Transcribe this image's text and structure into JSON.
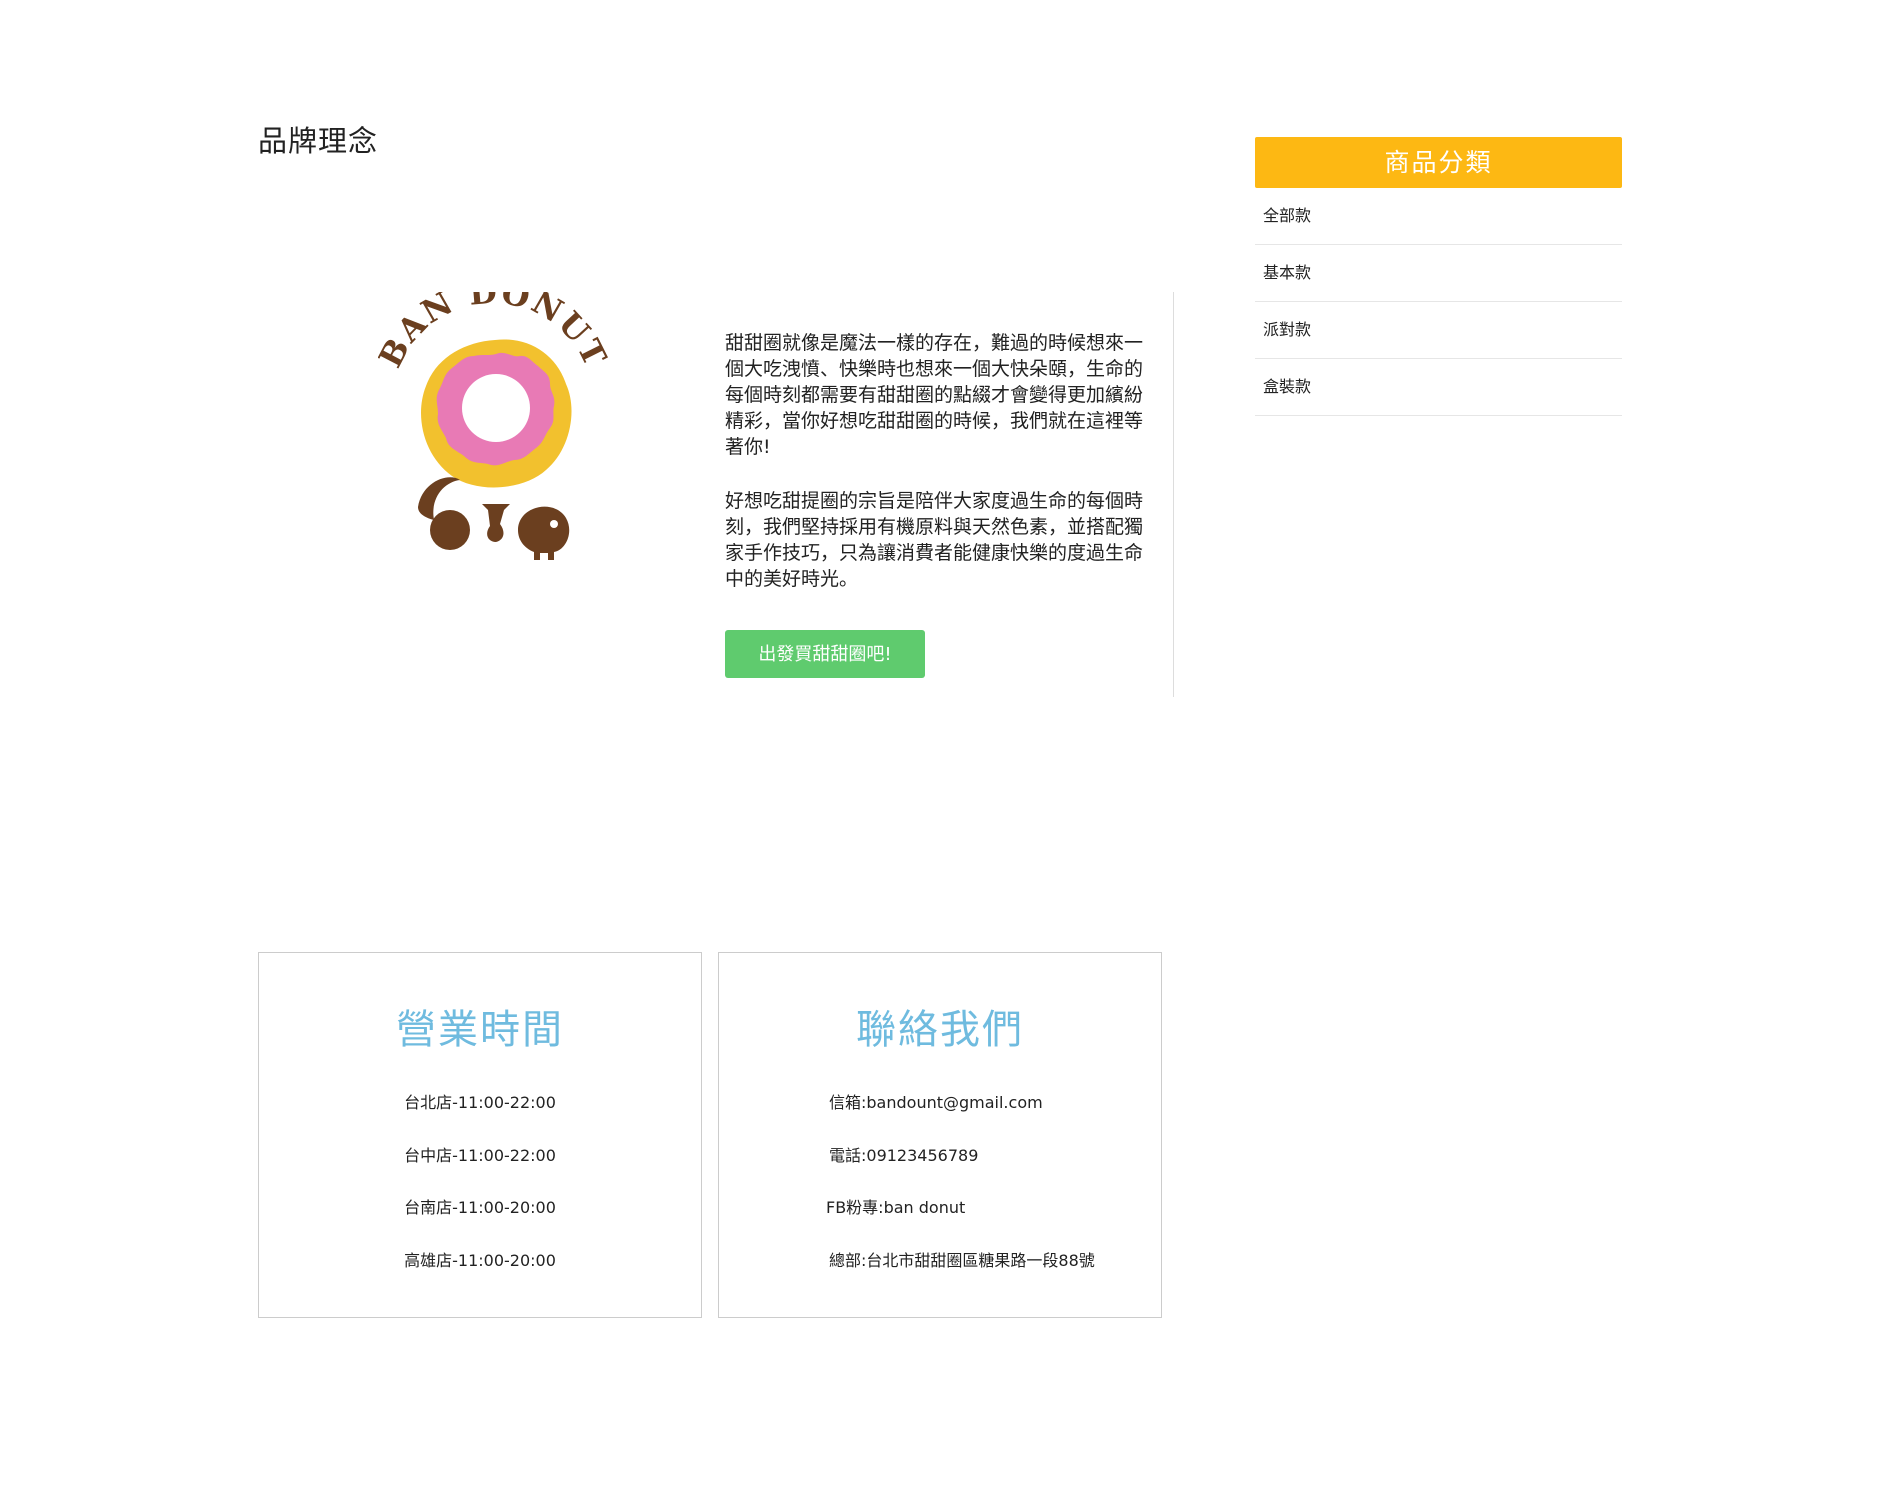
{
  "page": {
    "title": "品牌理念"
  },
  "brand": {
    "logo_text": "BAN DONUT",
    "paragraphs": [
      "甜甜圈就像是魔法一樣的存在，難過的時候想來一個大吃洩憤、快樂時也想來一個大快朵頤，生命的每個時刻都需要有甜甜圈的點綴才會變得更加繽紛精彩，當你好想吃甜甜圈的時候，我們就在這裡等著你!",
      "好想吃甜提圈的宗旨是陪伴大家度過生命的每個時刻，我們堅持採用有機原料與天然色素，並搭配獨家手作技巧，只為讓消費者能健康快樂的度過生命中的美好時光。"
    ],
    "cta_label": "出發買甜甜圈吧!",
    "cta_color": "#5fcb6e"
  },
  "categories": {
    "header": "商品分類",
    "header_color": "#fdb813",
    "items": [
      {
        "label": "全部款"
      },
      {
        "label": "基本款"
      },
      {
        "label": "派對款"
      },
      {
        "label": "盒裝款"
      }
    ]
  },
  "hours": {
    "title": "營業時間",
    "items": [
      "台北店-11:00-22:00",
      "台中店-11:00-22:00",
      "台南店-11:00-20:00",
      "高雄店-11:00-20:00"
    ]
  },
  "contact": {
    "title": "聯絡我們",
    "items": [
      "信箱:bandount@gmail.com",
      "電話:09123456789",
      "FB粉專:ban donut",
      "總部:台北市甜甜圈區糖果路一段88號"
    ]
  },
  "colors": {
    "info_title": "#6fbbdf",
    "donut_icing": "#e87ab5",
    "donut_dough": "#f2c12e",
    "logo_brown": "#6b3f1f"
  }
}
